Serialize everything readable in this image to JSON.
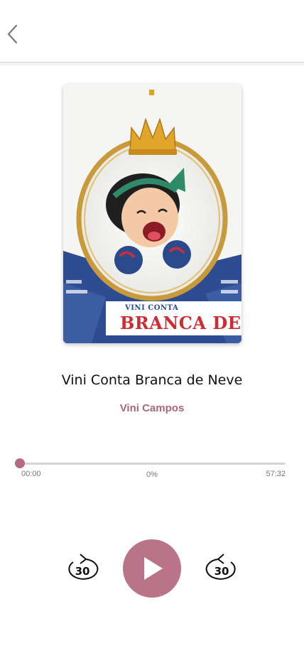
{
  "header": {
    "back_icon": "chevron-left-icon"
  },
  "book": {
    "cover": {
      "small_text": "VINI CONTA",
      "title_text": "BRANCA DE NEVE"
    },
    "title": "Vini Conta Branca de Neve",
    "author": "Vini Campos"
  },
  "player": {
    "elapsed": "00:00",
    "percent_label": "0%",
    "total": "57:32",
    "progress_fraction": 0.0,
    "skip_back_label": "30",
    "skip_forward_label": "30",
    "play_icon": "play-icon",
    "skip_back_icon": "rewind-30-icon",
    "skip_forward_icon": "forward-30-icon"
  },
  "colors": {
    "accent": "#b97489",
    "author": "#a8677e",
    "track": "#d5d5d5",
    "cover_blue": "#2b4a8c",
    "cover_red": "#d02a33"
  }
}
